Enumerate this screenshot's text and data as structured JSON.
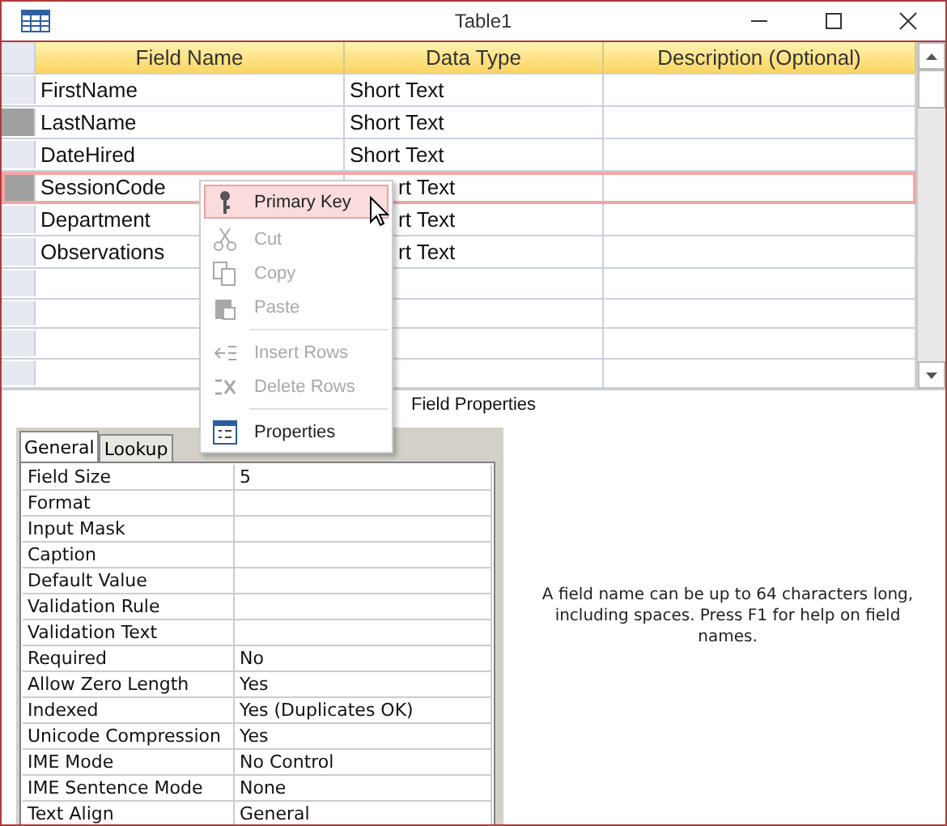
{
  "window": {
    "title": "Table1"
  },
  "grid": {
    "columns": [
      "Field Name",
      "Data Type",
      "Description (Optional)"
    ],
    "rows": [
      {
        "field_name": "FirstName",
        "data_type": "Short Text",
        "marked": false,
        "selected": false
      },
      {
        "field_name": "LastName",
        "data_type": "Short Text",
        "marked": true,
        "selected": false
      },
      {
        "field_name": "DateHired",
        "data_type": "Short Text",
        "marked": false,
        "selected": false
      },
      {
        "field_name": "SessionCode",
        "data_type": "rt Text",
        "marked": true,
        "selected": true
      },
      {
        "field_name": "Department",
        "data_type": "rt Text",
        "marked": false,
        "selected": false
      },
      {
        "field_name": "Observations",
        "data_type": "rt Text",
        "marked": false,
        "selected": false
      }
    ]
  },
  "context_menu": {
    "items": [
      {
        "kind": "key",
        "label": "Primary Key",
        "disabled": false,
        "highlighted": true
      },
      {
        "kind": "cut",
        "label": "Cut",
        "disabled": true,
        "highlighted": false
      },
      {
        "kind": "copy",
        "label": "Copy",
        "disabled": true,
        "highlighted": false
      },
      {
        "kind": "paste",
        "label": "Paste",
        "disabled": true,
        "highlighted": false
      },
      {
        "kind": "separator"
      },
      {
        "kind": "insert",
        "label": "Insert Rows",
        "disabled": true,
        "highlighted": false
      },
      {
        "kind": "delete",
        "label": "Delete Rows",
        "disabled": true,
        "highlighted": false
      },
      {
        "kind": "separator"
      },
      {
        "kind": "properties",
        "label": "Properties",
        "disabled": false,
        "highlighted": false
      }
    ]
  },
  "field_properties": {
    "title": "Field Properties",
    "tabs": [
      {
        "label": "General",
        "selected": true
      },
      {
        "label": "Lookup",
        "selected": false
      }
    ],
    "rows": [
      {
        "label": "Field Size",
        "value": "5"
      },
      {
        "label": "Format"
      },
      {
        "label": "Input Mask"
      },
      {
        "label": "Caption"
      },
      {
        "label": "Default Value"
      },
      {
        "label": "Validation Rule"
      },
      {
        "label": "Validation Text"
      },
      {
        "label": "Required",
        "value": "No"
      },
      {
        "label": "Allow Zero Length",
        "value": "Yes"
      },
      {
        "label": "Indexed",
        "value": "Yes (Duplicates OK)"
      },
      {
        "label": "Unicode Compression",
        "value": "Yes"
      },
      {
        "label": "IME Mode",
        "value": "No Control"
      },
      {
        "label": "IME Sentence Mode",
        "value": "None"
      },
      {
        "label": "Text Align",
        "value": "General"
      }
    ],
    "help": "A field name can be up to 64 characters long, including spaces. Press F1 for help on field names."
  }
}
